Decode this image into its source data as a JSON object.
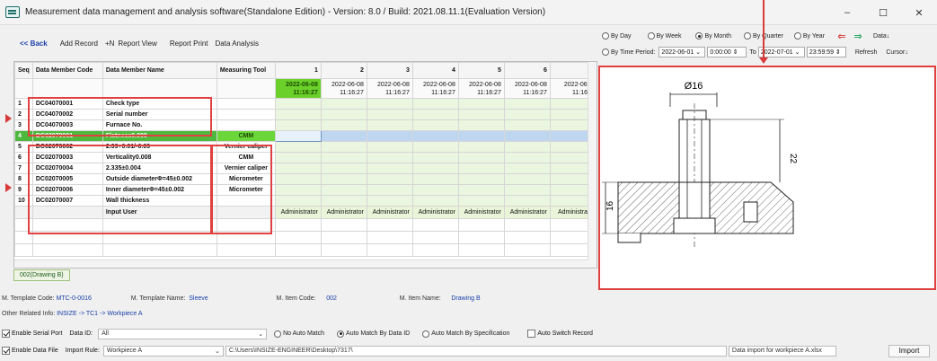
{
  "window": {
    "title": "Measurement data management and analysis software(Standalone Edition) - Version: 8.0 / Build: 2021.08.11.1(Evaluation Version)",
    "controls": [
      "–",
      "☐",
      "✕"
    ]
  },
  "toolbar": {
    "back": "<< Back",
    "add_record": "Add Record",
    "add_n": "+N",
    "report_view": "Report View",
    "report_print": "Report Print",
    "data_analysis": "Data Analysis"
  },
  "period": {
    "by_day": "By Day",
    "by_week": "By Week",
    "by_month": "By Month",
    "by_quarter": "By Quarter",
    "by_year": "By Year",
    "by_time_period": "By Time Period:",
    "selected": "By Month",
    "from_date": "2022-06-01",
    "from_time": "0:00:00",
    "to_label": "To",
    "to_date": "2022-07-01",
    "to_time": "23:59:59",
    "data_btn": "Data↓",
    "refresh": "Refresh",
    "cursor": "Cursor↓"
  },
  "grid": {
    "headers": [
      "Seq",
      "Data Member Code",
      "Data Member Name",
      "Measuring Tool",
      "1",
      "2",
      "3",
      "4",
      "5",
      "6",
      ""
    ],
    "dates": [
      {
        "d": "2022-06-08",
        "t": "11:16:27"
      },
      {
        "d": "2022-06-08",
        "t": "11:16:27"
      },
      {
        "d": "2022-06-08",
        "t": "11:16:27"
      },
      {
        "d": "2022-06-08",
        "t": "11:16:27"
      },
      {
        "d": "2022-06-08",
        "t": "11:16:27"
      },
      {
        "d": "2022-06-08",
        "t": "11:16:27"
      },
      {
        "d": "2022-06-0",
        "t": "11:16:2"
      }
    ],
    "rows": [
      {
        "seq": "1",
        "code": "DC04070001",
        "name": "Check type",
        "tool": ""
      },
      {
        "seq": "2",
        "code": "DC04070002",
        "name": "Serial number",
        "tool": ""
      },
      {
        "seq": "3",
        "code": "DC04070003",
        "name": "Furnace No.",
        "tool": ""
      },
      {
        "seq": "4",
        "code": "DC02070001",
        "name": "Flatness0.008",
        "tool": "CMM"
      },
      {
        "seq": "5",
        "code": "DC02070002",
        "name": "2.39+0.01/-0.03",
        "tool": "Vernier caliper"
      },
      {
        "seq": "6",
        "code": "DC02070003",
        "name": "Verticality0.008",
        "tool": "CMM"
      },
      {
        "seq": "7",
        "code": "DC02070004",
        "name": "2.335±0.004",
        "tool": "Vernier caliper"
      },
      {
        "seq": "8",
        "code": "DC02070005",
        "name": "Outside diameterΦ=45±0.002",
        "tool": "Micrometer"
      },
      {
        "seq": "9",
        "code": "DC02070006",
        "name": "Inner diameterΦ=45±0.002",
        "tool": "Micrometer"
      },
      {
        "seq": "10",
        "code": "DC02070007",
        "name": "Wall thickness",
        "tool": ""
      }
    ],
    "input_user_label": "Input User",
    "input_users": [
      "Administrator",
      "Administrator",
      "Administrator",
      "Administrator",
      "Administrator",
      "Administrator",
      "Administrato"
    ],
    "tab": "002(Drawing B)"
  },
  "drawing": {
    "dim_top": "Ø16",
    "dim_right": "22",
    "dim_left": "16"
  },
  "info": {
    "template_code_label": "M. Template Code:",
    "template_code": "MTC-0-0016",
    "template_name_label": "M. Template Name:",
    "template_name": "Sleeve",
    "item_code_label": "M. Item Code:",
    "item_code": "002",
    "item_name_label": "M. Item Name:",
    "item_name": "Drawing B",
    "other_label": "Other Related Info:",
    "other_value": "INSIZE -> TC1 -> Workpiece A"
  },
  "serial": {
    "enable_label": "Enable Serial Port",
    "data_id_label": "Data ID:",
    "data_id_value": "All",
    "no_auto": "No Auto Match",
    "auto_by_id": "Auto Match By Data ID",
    "auto_by_spec": "Auto Match By Specification",
    "auto_switch": "Auto Switch Record"
  },
  "datafile": {
    "enable_label": "Enable Data File",
    "import_rule_label": "Import Rule:",
    "import_rule_value": "Workpiece A",
    "path": "C:\\Users\\INSIZE-ENGINEER\\Desktop\\7317\\",
    "file_name": "Data import for workpiece A.xlsx",
    "import_btn": "Import"
  },
  "colors": {
    "accent_green": "#6bd12a",
    "highlight_red": "#e04040",
    "selection_blue": "#bfd6f0"
  }
}
